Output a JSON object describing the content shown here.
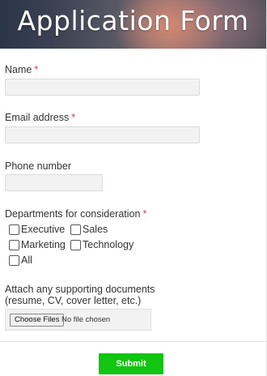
{
  "header": {
    "title": "Application Form"
  },
  "fields": {
    "name": {
      "label": "Name",
      "required_mark": "*",
      "value": ""
    },
    "email": {
      "label": "Email address",
      "required_mark": "*",
      "value": ""
    },
    "phone": {
      "label": "Phone number",
      "value": ""
    }
  },
  "departments": {
    "label": "Departments for consideration",
    "required_mark": "*",
    "options": [
      {
        "label": "Executive",
        "checked": false
      },
      {
        "label": "Sales",
        "checked": false
      },
      {
        "label": "Marketing",
        "checked": false
      },
      {
        "label": "Technology",
        "checked": false
      },
      {
        "label": "All",
        "checked": false
      }
    ]
  },
  "attachments": {
    "label_line1": "Attach any supporting documents",
    "label_line2": "(resume, CV, cover letter, etc.)",
    "button_label": "Choose Files",
    "status": "No file chosen"
  },
  "submit": {
    "label": "Submit"
  },
  "colors": {
    "required": "#e03a3a",
    "submit_bg": "#11c511",
    "input_bg": "#f2f2f2"
  }
}
